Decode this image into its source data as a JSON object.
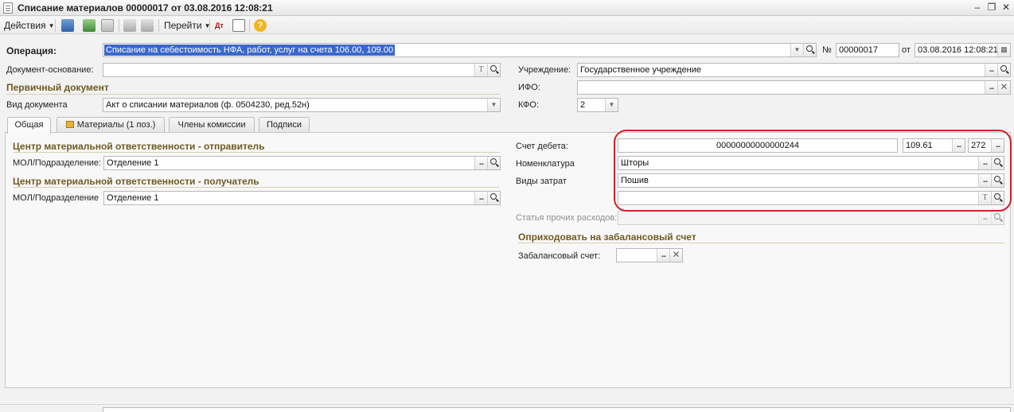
{
  "window": {
    "title": "Списание материалов 00000017 от 03.08.2016 12:08:21"
  },
  "toolbar": {
    "actions_label": "Действия",
    "goto_label": "Перейти"
  },
  "header": {
    "operation_label": "Операция:",
    "operation_value": "Списание на себестоимость НФА, работ, услуг на счета 106.00, 109.00",
    "number_label": "№",
    "number_value": "00000017",
    "date_label": "от",
    "date_value": "03.08.2016 12:08:21",
    "basis_doc_label": "Документ-основание:",
    "basis_doc_value": "",
    "institution_label": "Учреждение:",
    "institution_value": "Государственное учреждение",
    "primary_doc_section": "Первичный документ",
    "ifo_label": "ИФО:",
    "ifo_value": "",
    "doc_type_label": "Вид документа",
    "doc_type_value": "Акт о списании материалов (ф. 0504230, ред.52н)",
    "kfo_label": "КФО:",
    "kfo_value": "2"
  },
  "tabs": [
    {
      "label": "Общая"
    },
    {
      "label": "Материалы (1 поз.)"
    },
    {
      "label": "Члены комиссии"
    },
    {
      "label": "Подписи"
    }
  ],
  "general": {
    "sender_section": "Центр материальной ответственности - отправитель",
    "sender_mol_label": "МОЛ/Подразделение:",
    "sender_mol_value": "Отделение 1",
    "receiver_section": "Центр материальной ответственности - получатель",
    "receiver_mol_label": "МОЛ/Подразделение",
    "receiver_mol_value": "Отделение 1",
    "debit_account_label": "Счет дебета:",
    "debit_account_value": "00000000000000244",
    "debit_subaccount_value": "109.61",
    "debit_kosgu_value": "272",
    "nomenclature_label": "Номенклатура",
    "nomenclature_value": "Шторы",
    "cost_type_label": "Виды затрат",
    "cost_type_value": "Пошив",
    "extra_field_value": "",
    "other_expenses_label": "Статья прочих расходов:",
    "offbalance_section": "Оприходовать на забалансовый счет",
    "offbalance_label": "Забалансовый счет:",
    "offbalance_value": ""
  },
  "colors": {
    "highlight_ring": "#d0212b",
    "section_text": "#6e5a22",
    "selection_bg": "#3a67c9"
  }
}
